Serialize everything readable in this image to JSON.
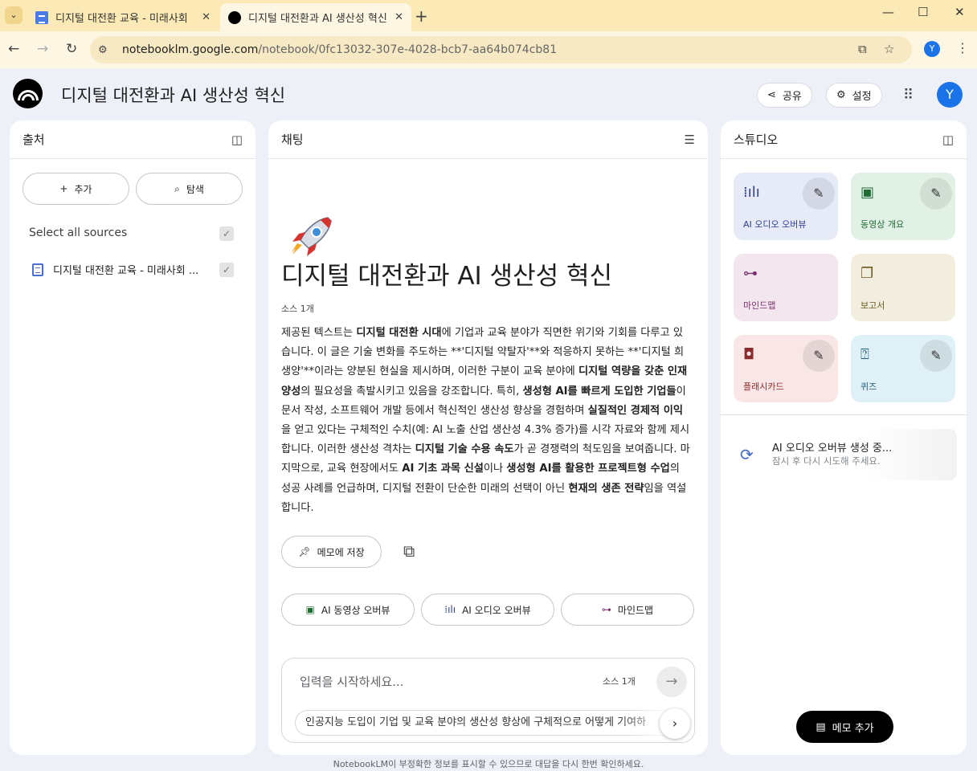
{
  "browser": {
    "tabs": [
      {
        "title": "디지털 대전환 교육 - 미래사회"
      },
      {
        "title": "디지털 대전환과 AI 생산성 혁신"
      }
    ],
    "url_host": "notebooklm.google.com",
    "url_path": "/notebook/0fc13032-307e-4028-bcb7-aa64b074cb81",
    "profile_initial": "Y"
  },
  "header": {
    "title": "디지털 대전환과 AI 생산성 혁신",
    "share_label": "공유",
    "settings_label": "설정",
    "avatar_initial": "Y"
  },
  "sources": {
    "title": "출처",
    "add_label": "추가",
    "explore_label": "탐색",
    "select_all_label": "Select all sources",
    "items": [
      {
        "label": "디지털 대전환 교육 - 미래사회 ..."
      }
    ]
  },
  "chat": {
    "title": "채팅",
    "notebook_emoji": "🚀",
    "notebook_title": "디지털 대전환과 AI 생산성 혁신",
    "source_count": "소스 1개",
    "summary_parts": [
      {
        "t": "제공된 텍스트는 ",
        "b": false
      },
      {
        "t": "디지털 대전환 시대",
        "b": true
      },
      {
        "t": "에 기업과 교육 분야가 직면한 위기와 기회를 다루고 있습니다. 이 글은 기술 변화를 주도하는 **'디지털 약탈자'**와 적응하지 못하는 **'디지털 희생양'**이라는 양분된 현실을 제시하며, 이러한 구분이 교육 분야에 ",
        "b": false
      },
      {
        "t": "디지털 역량을 갖춘 인재 양성",
        "b": true
      },
      {
        "t": "의 필요성을 촉발시키고 있음을 강조합니다. 특히, ",
        "b": false
      },
      {
        "t": "생성형 AI를 빠르게 도입한 기업들",
        "b": true
      },
      {
        "t": "이 문서 작성, 소프트웨어 개발 등에서 혁신적인 생산성 향상을 경험하며 ",
        "b": false
      },
      {
        "t": "실질적인 경제적 이익",
        "b": true
      },
      {
        "t": "을 얻고 있다는 구체적인 수치(예: AI 노출 산업 생산성 4.3% 증가)를 시각 자료와 함께 제시합니다. 이러한 생산성 격차는 ",
        "b": false
      },
      {
        "t": "디지털 기술 수용 속도",
        "b": true
      },
      {
        "t": "가 곧 경쟁력의 척도임을 보여줍니다. 마지막으로, 교육 현장에서도 ",
        "b": false
      },
      {
        "t": "AI 기초 과목 신설",
        "b": true
      },
      {
        "t": "이나 ",
        "b": false
      },
      {
        "t": "생성형 AI를 활용한 프로젝트형 수업",
        "b": true
      },
      {
        "t": "의 성공 사례를 언급하며, 디지털 전환이 단순한 미래의 선택이 아닌 ",
        "b": false
      },
      {
        "t": "현재의 생존 전략",
        "b": true
      },
      {
        "t": "임을 역설합니다.",
        "b": false
      }
    ],
    "save_note_label": "메모에 저장",
    "chips": [
      "AI 동영상 오버뷰",
      "AI 오디오 오버뷰",
      "마인드맵"
    ],
    "input_placeholder": "입력을 시작하세요...",
    "input_source_count": "소스 1개",
    "suggestion": "인공지능 도입이 기업 및 교육 분야의 생산성 향상에 구체적으로 어떻게 기여하"
  },
  "studio": {
    "title": "스튜디오",
    "cards": [
      {
        "label": "AI 오디오 오버뷰",
        "bg": "#e7ebf8",
        "fg": "#2f3e8f",
        "icon": "audio-wave-icon"
      },
      {
        "label": "동영상 개요",
        "bg": "#e2f1e6",
        "fg": "#1e6b34",
        "icon": "video-icon"
      },
      {
        "label": "마인드맵",
        "bg": "#f3e6ef",
        "fg": "#7a2e6d",
        "icon": "mindmap-icon"
      },
      {
        "label": "보고서",
        "bg": "#f1eedf",
        "fg": "#6a5a1f",
        "icon": "report-icon"
      },
      {
        "label": "플래시카드",
        "bg": "#f8e7e6",
        "fg": "#8c2b2b",
        "icon": "flashcard-icon"
      },
      {
        "label": "퀴즈",
        "bg": "#dff0f6",
        "fg": "#1f5f78",
        "icon": "quiz-icon"
      }
    ],
    "generating_title": "AI 오디오 오버뷰 생성 중...",
    "generating_sub": "잠시 후 다시 시도해 주세요.",
    "add_memo_label": "메모 추가"
  },
  "footer": "NotebookLM이 부정확한 정보를 표시할 수 있으므로 대답을 다시 한번 확인하세요."
}
